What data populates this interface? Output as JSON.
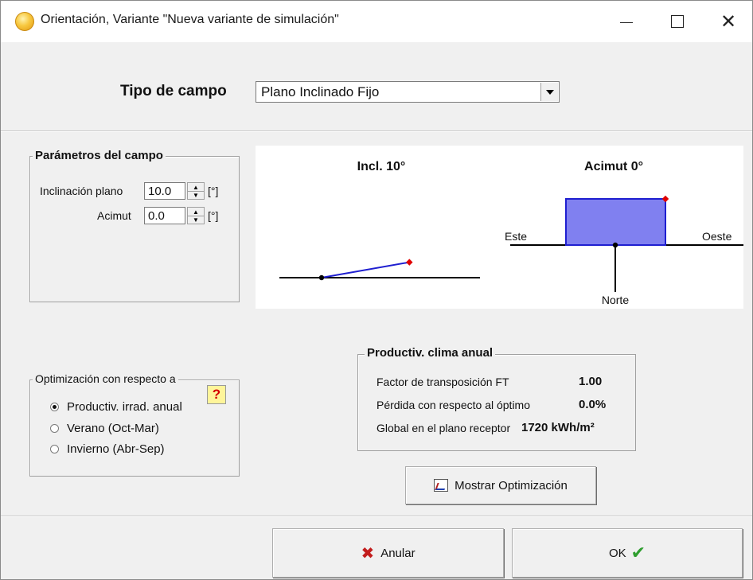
{
  "window": {
    "title": "Orientación, Variante \"Nueva variante de simulación\"",
    "controls": {
      "minimize": "—",
      "maximize": "☐",
      "close": "✕"
    }
  },
  "field_type": {
    "label": "Tipo de campo",
    "selected": "Plano Inclinado Fijo"
  },
  "parameters": {
    "title": "Parámetros del campo",
    "tilt_label": "Inclinación plano",
    "tilt_value": "10.0",
    "azimuth_label": "Acimut",
    "azimuth_value": "0.0",
    "unit": "[°]"
  },
  "diagram": {
    "tilt_title": "Incl. 10°",
    "azimuth_title": "Acimut 0°",
    "east_label": "Este",
    "west_label": "Oeste",
    "north_label": "Norte",
    "tilt_deg": 10,
    "azimuth_deg": 0,
    "colors": {
      "panel": "#8080f0",
      "panel_edge": "#1f1fd0",
      "tilt_line": "#1f1fd0",
      "marker": "#e00000"
    }
  },
  "optimization": {
    "title": "Optimización con respecto a",
    "options": [
      {
        "label": "Productiv. irrad. anual",
        "checked": true
      },
      {
        "label": "Verano (Oct-Mar)",
        "checked": false
      },
      {
        "label": "Invierno (Abr-Sep)",
        "checked": false
      }
    ],
    "help_label": "?"
  },
  "results": {
    "title": "Productiv. clima anual",
    "rows": [
      {
        "label": "Factor de transposición FT",
        "value": "1.00"
      },
      {
        "label": "Pérdida con respecto al óptimo",
        "value": "0.0%"
      },
      {
        "label": "Global en el plano receptor",
        "value": "1720 kWh/m²"
      }
    ]
  },
  "buttons": {
    "show_optimization": "Mostrar Optimización",
    "cancel": "Anular",
    "ok": "OK"
  }
}
